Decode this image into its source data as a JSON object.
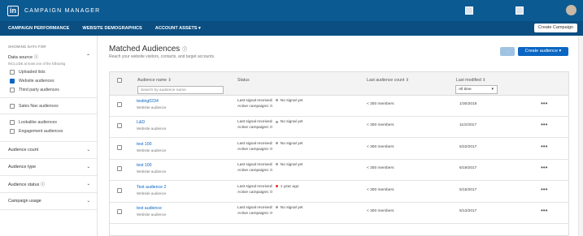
{
  "app": {
    "logo_text": "in",
    "title": "CAMPAIGN MANAGER",
    "account_text": "",
    "colors": {
      "topbar": "#0c5a92",
      "navbar": "#0a4e82",
      "link": "#0a66c2",
      "primary": "#0a66c2",
      "status_grey": "#9e9e9e",
      "status_red": "#e0322b"
    }
  },
  "nav": {
    "items": [
      "CAMPAIGN PERFORMANCE",
      "WEBSITE DEMOGRAPHICS",
      "ACCOUNT ASSETS"
    ],
    "account_assets_caret": "▾",
    "create_campaign": "Create Campaign"
  },
  "sidebar": {
    "caption": "SHOWING DATA FOR",
    "data_source": {
      "label": "Data source",
      "help_icon": "ⓘ",
      "hint": "INCLUDE at least one of the following",
      "chevron": "⌃"
    },
    "options": [
      {
        "label": "Uploaded lists",
        "checked": false
      },
      {
        "label": "Website audiences",
        "checked": true
      },
      {
        "label": "Third party audiences",
        "checked": false
      },
      {
        "label": "Sales Nav audiences",
        "checked": false
      },
      {
        "label": "Lookalike audiences",
        "checked": false
      },
      {
        "label": "Engagement audiences",
        "checked": false
      }
    ],
    "sections": [
      {
        "label": "Audience count",
        "chevron": "⌄"
      },
      {
        "label": "Audience type",
        "chevron": "⌄"
      },
      {
        "label": "Audience status",
        "chevron": "⌄"
      },
      {
        "label": "Campaign usage",
        "chevron": "⌄"
      }
    ]
  },
  "main": {
    "title": "Matched Audiences",
    "title_help": "ⓘ",
    "subtitle": "Reach your website visitors, contacts, and target accounts.",
    "disabled_button": "···",
    "create_audience": "Create audience ▾"
  },
  "table": {
    "headers": {
      "name": "Audience name ⇕",
      "status": "Status",
      "count": "Last audience count ⇕",
      "modified": "Last modified ⇕"
    },
    "search_placeholder": "Search by audience name",
    "date_filter": "All time",
    "date_caret": "▾",
    "rows": [
      {
        "name": "testing0234",
        "type": "Website audience",
        "signal_label": "Last signal received:",
        "signal": "No signal yet",
        "signal_color": "#9e9e9e",
        "campaigns": "Active campaigns: 0",
        "count": "< 300 members",
        "modified": "1/30/2018",
        "more": "•••"
      },
      {
        "name": "L&D",
        "type": "Website audience",
        "signal_label": "Last signal received:",
        "signal": "No signal yet",
        "signal_color": "#9e9e9e",
        "campaigns": "Active campaigns: 0",
        "count": "< 300 members",
        "modified": "11/2/2017",
        "more": "•••"
      },
      {
        "name": "test 100",
        "type": "Website audience",
        "signal_label": "Last signal received:",
        "signal": "No signal yet",
        "signal_color": "#9e9e9e",
        "campaigns": "Active campaigns: 0",
        "count": "< 300 members",
        "modified": "6/22/2017",
        "more": "•••"
      },
      {
        "name": "test 100",
        "type": "Website audience",
        "signal_label": "Last signal received:",
        "signal": "No signal yet",
        "signal_color": "#9e9e9e",
        "campaigns": "Active campaigns: 0",
        "count": "< 300 members",
        "modified": "6/19/2017",
        "more": "•••"
      },
      {
        "name": "Test audience 2",
        "type": "Website audience",
        "signal_label": "Last signal received:",
        "signal": "1 year ago",
        "signal_color": "#e0322b",
        "campaigns": "Active campaigns: 0",
        "count": "< 300 members",
        "modified": "5/15/2017",
        "more": "•••"
      },
      {
        "name": "test audience",
        "type": "Website audience",
        "signal_label": "Last signal received:",
        "signal": "No signal yet",
        "signal_color": "#9e9e9e",
        "campaigns": "Active campaigns: 0",
        "count": "< 300 members",
        "modified": "5/13/2017",
        "more": "•••"
      }
    ]
  }
}
